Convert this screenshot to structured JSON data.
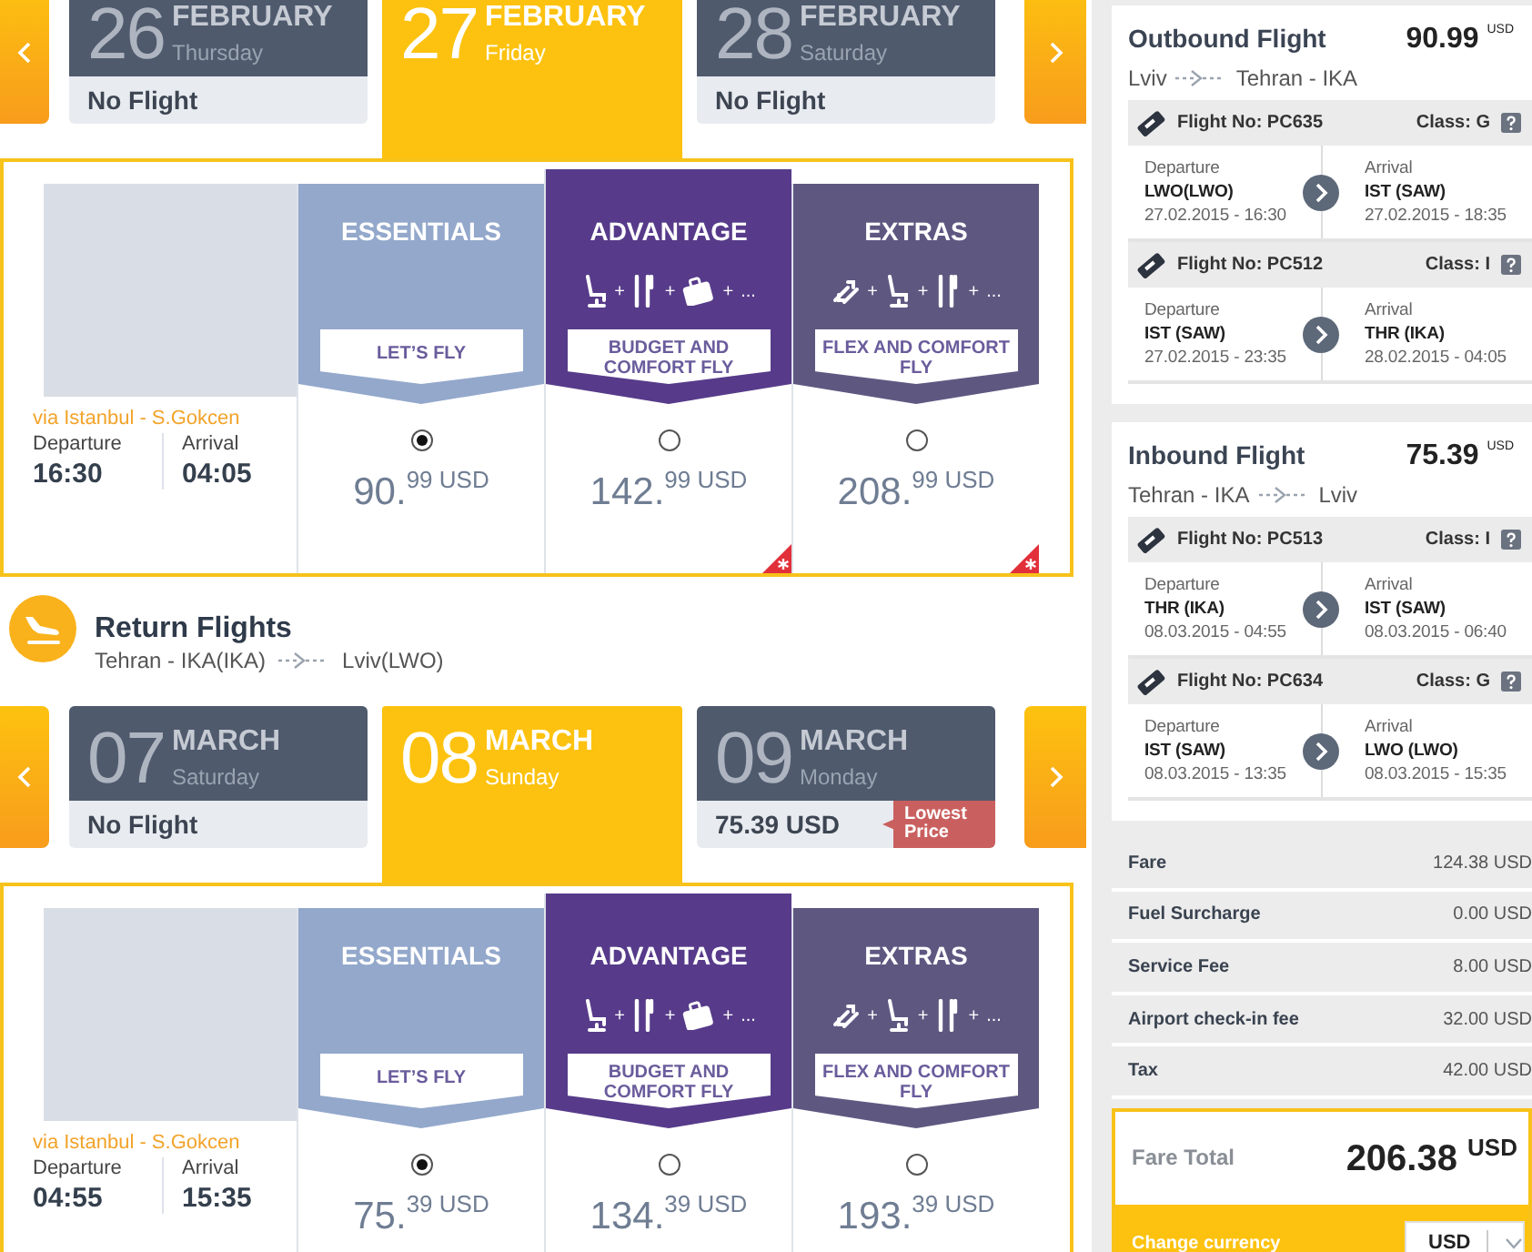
{
  "outbound": {
    "dates": [
      {
        "day": "26",
        "month": "FEBRUARY",
        "weekday": "Thursday",
        "status": "No Flight",
        "selected": false
      },
      {
        "day": "27",
        "month": "FEBRUARY",
        "weekday": "Friday",
        "selected": true
      },
      {
        "day": "28",
        "month": "FEBRUARY",
        "weekday": "Saturday",
        "status": "No Flight",
        "selected": false
      }
    ],
    "flight": {
      "via": "via Istanbul - S.Gokcen",
      "departure_label": "Departure",
      "departure_time": "16:30",
      "arrival_label": "Arrival",
      "arrival_time": "04:05"
    },
    "tiers": [
      {
        "kind": "essentials",
        "title": "ESSENTIALS",
        "tagline": "LET’S FLY",
        "price": "90.$^{99 USD}$",
        "selected": true,
        "flagged": false
      },
      {
        "kind": "advantage",
        "title": "ADVANTAGE",
        "features": [
          {
            "kind": "seat",
            "plus": "+"
          },
          {
            "kind": "cutlery",
            "plus": "+"
          },
          {
            "kind": "bag",
            "plus": "+"
          }
        ],
        "more": "...",
        "tagline": "BUDGET AND COMFORT FLY",
        "price": "142.$^{99 USD}$",
        "selected": false,
        "flagged": true
      },
      {
        "kind": "extras",
        "title": "EXTRAS",
        "features": [
          {
            "kind": "swap",
            "plus": "+"
          },
          {
            "kind": "seat",
            "plus": "+"
          },
          {
            "kind": "cutlery",
            "plus": "+"
          }
        ],
        "more": "...",
        "tagline": "FLEX AND COMFORT FLY",
        "price": "208.$^{99 USD}$",
        "selected": false,
        "flagged": true
      }
    ]
  },
  "return_header": {
    "title": "Return Flights",
    "from": "Tehran - IKA(IKA)",
    "to": "Lviv(LWO)"
  },
  "inbound": {
    "dates": [
      {
        "day": "07",
        "month": "MARCH",
        "weekday": "Saturday",
        "status": "No Flight",
        "selected": false
      },
      {
        "day": "08",
        "month": "MARCH",
        "weekday": "Sunday",
        "selected": true
      },
      {
        "day": "09",
        "month": "MARCH",
        "weekday": "Monday",
        "status": "75.39 USD",
        "badge": "Lowest Price",
        "selected": false
      }
    ],
    "flight": {
      "via": "via Istanbul - S.Gokcen",
      "departure_label": "Departure",
      "departure_time": "04:55",
      "arrival_label": "Arrival",
      "arrival_time": "15:35"
    },
    "tiers": [
      {
        "kind": "essentials",
        "title": "ESSENTIALS",
        "tagline": "LET’S FLY",
        "price": "75.$^{39 USD}$",
        "selected": true,
        "flagged": false
      },
      {
        "kind": "advantage",
        "title": "ADVANTAGE",
        "features": [
          {
            "kind": "seat",
            "plus": "+"
          },
          {
            "kind": "cutlery",
            "plus": "+"
          },
          {
            "kind": "bag",
            "plus": "+"
          }
        ],
        "more": "...",
        "tagline": "BUDGET AND COMFORT FLY",
        "price": "134.$^{39 USD}$",
        "selected": false,
        "flagged": false
      },
      {
        "kind": "extras",
        "title": "EXTRAS",
        "features": [
          {
            "kind": "swap",
            "plus": "+"
          },
          {
            "kind": "seat",
            "plus": "+"
          },
          {
            "kind": "cutlery",
            "plus": "+"
          }
        ],
        "more": "...",
        "tagline": "FLEX AND COMFORT FLY",
        "price": "193.$^{39 USD}$",
        "selected": false,
        "flagged": false
      }
    ]
  },
  "summary": {
    "flights": [
      {
        "title": "Outbound Flight",
        "price": "90.99 $^{USD}$",
        "from": "Lviv",
        "to": "Tehran - IKA",
        "segments": [
          {
            "flight_no": "Flight No: PC635",
            "class": "Class: G",
            "departure_label": "Departure",
            "departure_code": "LWO(LWO)",
            "departure_time": "27.02.2015 - 16:30",
            "arrival_label": "Arrival",
            "arrival_code": "IST (SAW)",
            "arrival_time": "27.02.2015 - 18:35"
          },
          {
            "flight_no": "Flight No: PC512",
            "class": "Class: I",
            "departure_label": "Departure",
            "departure_code": "IST (SAW)",
            "departure_time": "27.02.2015 - 23:35",
            "arrival_label": "Arrival",
            "arrival_code": "THR (IKA)",
            "arrival_time": "28.02.2015 - 04:05"
          }
        ]
      },
      {
        "title": "Inbound Flight",
        "price": "75.39 $^{USD}$",
        "from": "Tehran - IKA",
        "to": "Lviv",
        "segments": [
          {
            "flight_no": "Flight No: PC513",
            "class": "Class: I",
            "departure_label": "Departure",
            "departure_code": "THR (IKA)",
            "departure_time": "08.03.2015 - 04:55",
            "arrival_label": "Arrival",
            "arrival_code": "IST (SAW)",
            "arrival_time": "08.03.2015 - 06:40"
          },
          {
            "flight_no": "Flight No: PC634",
            "class": "Class: G",
            "departure_label": "Departure",
            "departure_code": "IST (SAW)",
            "departure_time": "08.03.2015 - 13:35",
            "arrival_label": "Arrival",
            "arrival_code": "LWO (LWO)",
            "arrival_time": "08.03.2015 - 15:35"
          }
        ]
      }
    ],
    "fares": [
      {
        "label": "Fare",
        "value": "124.38 USD"
      },
      {
        "label": "Fuel Surcharge",
        "value": "0.00 USD"
      },
      {
        "label": "Service Fee",
        "value": "8.00 USD"
      },
      {
        "label": "Airport check-in fee",
        "value": "32.00 USD"
      },
      {
        "label": "Tax",
        "value": "42.00 USD"
      }
    ],
    "total": {
      "label": "Fare Total",
      "amount": "206.38 $^{USD}$"
    },
    "currency": {
      "label": "Change currency",
      "value": "USD"
    }
  }
}
